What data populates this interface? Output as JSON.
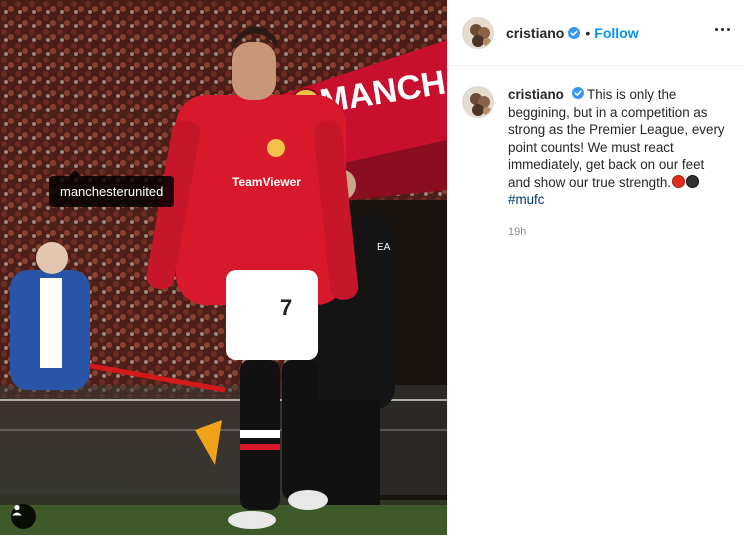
{
  "photo": {
    "tag_label": "manchesterunited",
    "banner_text": "MANCH",
    "shirt_sponsor": "TeamViewer",
    "shirt_number": "7",
    "corner_badge": "EA",
    "colors": {
      "shirt": "#d7192b",
      "banner": "#c8102e",
      "crowd": "#4a1d17"
    }
  },
  "header": {
    "username": "cristiano",
    "separator": "•",
    "follow_label": "Follow"
  },
  "caption": {
    "username": "cristiano",
    "text": "This is only the beggining, but in a competition as strong as the Premier League, every point counts! We must react immediately, get back on our feet and show our true strength.",
    "hashtag": "#mufc",
    "time": "19h"
  },
  "colors": {
    "follow": "#0095f6",
    "verified": "#3897f0",
    "hashtag": "#00376b",
    "muted": "#8e8e8e"
  }
}
